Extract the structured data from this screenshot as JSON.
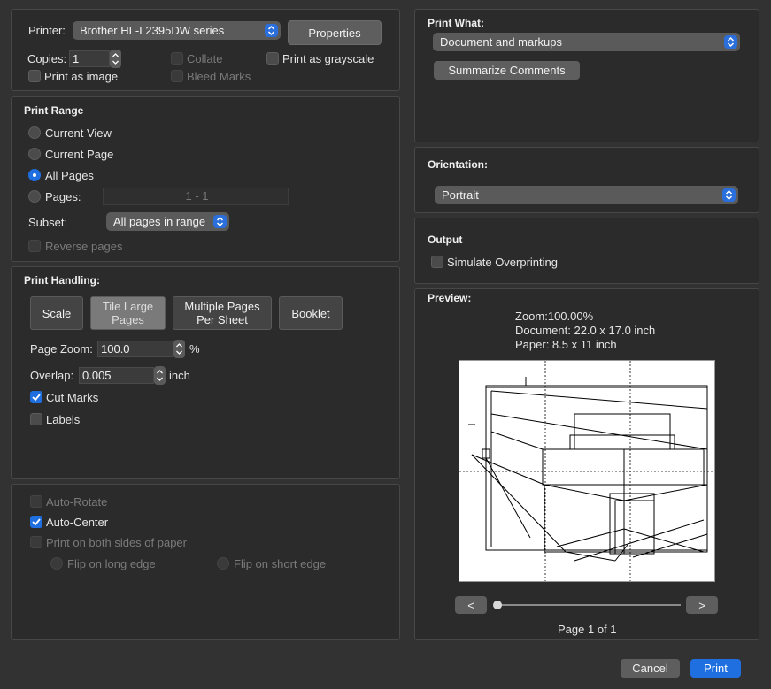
{
  "printer": {
    "label": "Printer:",
    "value": "Brother HL-L2395DW series",
    "properties_button": "Properties",
    "copies_label": "Copies:",
    "copies_value": "1",
    "collate": "Collate",
    "grayscale": "Print as grayscale",
    "print_as_image": "Print as image",
    "bleed_marks": "Bleed Marks"
  },
  "range": {
    "title": "Print Range",
    "current_view": "Current View",
    "current_page": "Current Page",
    "all_pages": "All Pages",
    "pages_label": "Pages:",
    "pages_value": "1 - 1",
    "subset_label": "Subset:",
    "subset_value": "All pages in range",
    "reverse": "Reverse pages"
  },
  "handling": {
    "title": "Print Handling:",
    "scale": "Scale",
    "tile_large": "Tile Large Pages",
    "multiple": "Multiple Pages Per Sheet",
    "booklet": "Booklet",
    "zoom_label": "Page Zoom:",
    "zoom_value": "100.0",
    "zoom_unit": "%",
    "overlap_label": "Overlap:",
    "overlap_value": "0.005",
    "overlap_unit": "inch",
    "cut_marks": "Cut Marks",
    "labels": "Labels"
  },
  "misc": {
    "auto_rotate": "Auto-Rotate",
    "auto_center": "Auto-Center",
    "both_sides": "Print on both sides of paper",
    "flip_long": "Flip on long edge",
    "flip_short": "Flip on short edge"
  },
  "what": {
    "title": "Print What:",
    "value": "Document and markups",
    "summarize": "Summarize Comments"
  },
  "orientation": {
    "title": "Orientation:",
    "value": "Portrait"
  },
  "output": {
    "title": "Output",
    "simulate": "Simulate Overprinting"
  },
  "preview": {
    "title": "Preview:",
    "zoom": "Zoom:100.00%",
    "document": "Document: 22.0 x 17.0 inch",
    "paper": "Paper: 8.5 x 11 inch",
    "prev": "<",
    "next": ">",
    "page": "Page 1 of 1"
  },
  "footer": {
    "cancel": "Cancel",
    "print": "Print"
  },
  "colors": {
    "accent": "#1f6fe0",
    "background": "#323232",
    "panel": "#2b2b2b"
  }
}
